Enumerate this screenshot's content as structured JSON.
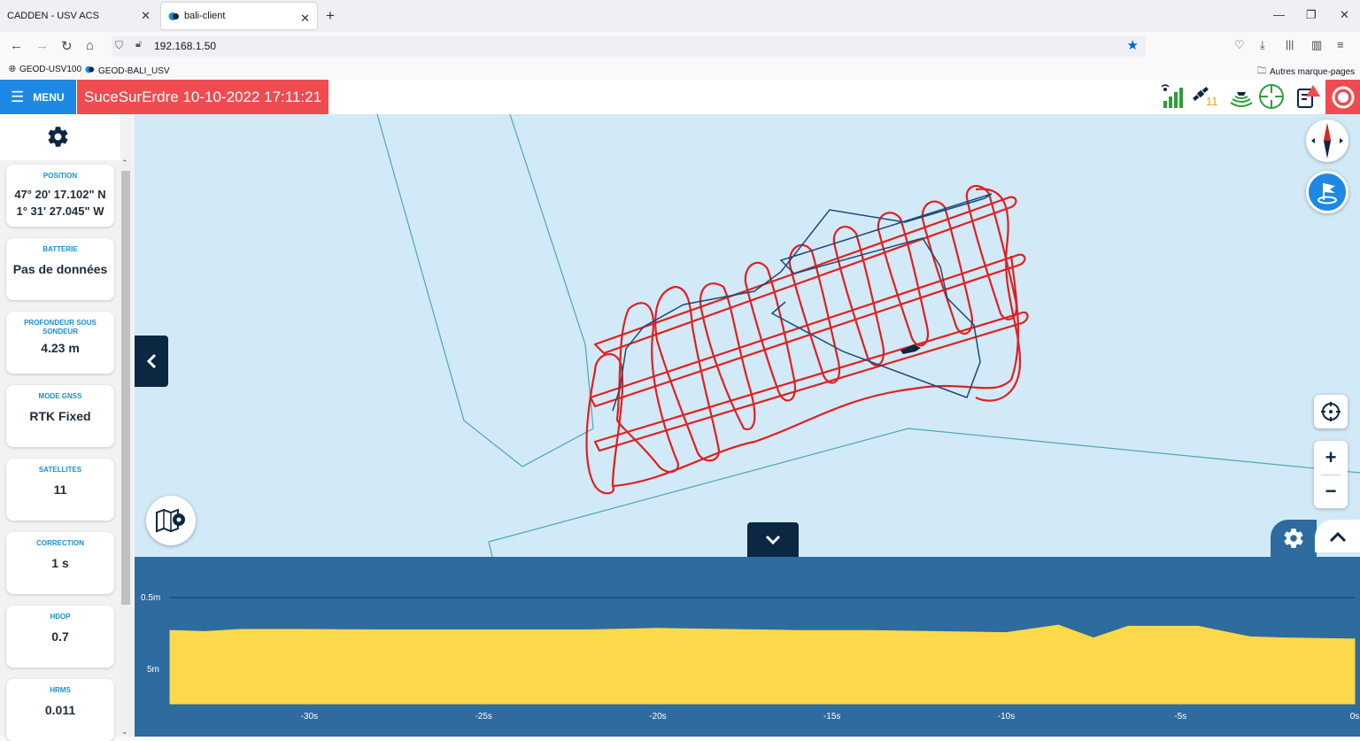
{
  "browser": {
    "tabs": [
      {
        "title": "CADDEN - USV ACS"
      },
      {
        "title": "bali-client"
      }
    ],
    "url": "192.168.1.50",
    "bookmarks": [
      "GEOD-USV100",
      "GEOD-BALI_USV"
    ],
    "other_bookmarks": "Autres marque-pages"
  },
  "app": {
    "menu_label": "MENU",
    "title": "SuceSurErdre 10-10-2022 17:11:21",
    "header_icons": [
      "signal-icon",
      "satellite-icon",
      "sonar-icon",
      "crosshair-icon",
      "alert-document-icon",
      "record-stop-icon"
    ],
    "satellites_badge": "11",
    "accent_color": "#1e88e5",
    "title_bg_color": "#f04b50"
  },
  "sidebar": {
    "cards": [
      {
        "label": "POSITION",
        "value": "47° 20' 17.102\" N",
        "value2": "1° 31' 27.045\" W"
      },
      {
        "label": "BATTERIE",
        "value": "Pas de données"
      },
      {
        "label": "PROFONDEUR SOUS SONDEUR",
        "value": "4.23 m"
      },
      {
        "label": "MODE GNSS",
        "value": "RTK Fixed"
      },
      {
        "label": "SATELLITES",
        "value": "11"
      },
      {
        "label": "CORRECTION",
        "value": "1 s"
      },
      {
        "label": "HDOP",
        "value": "0.7"
      },
      {
        "label": "HRMS",
        "value": "0.011"
      }
    ]
  },
  "map": {
    "water_color": "#d2e9f7",
    "track_color": "#e02020",
    "path_color": "#1b4a78",
    "controls": [
      "compass-icon",
      "flag-icon",
      "locate-icon",
      "zoom-in-button",
      "zoom-out-button",
      "map-settings-icon"
    ]
  },
  "depth_chart": {
    "y_labels": [
      "0.5m",
      "5m"
    ],
    "x_labels": [
      "-30s",
      "-25s",
      "-20s",
      "-15s",
      "-10s",
      "-5s",
      "0s"
    ]
  },
  "chart_data": {
    "type": "area",
    "x": [
      -34,
      -33,
      -32,
      -30,
      -28,
      -26,
      -24,
      -22,
      -20,
      -18,
      -16,
      -14,
      -12,
      -10,
      -8.5,
      -7.5,
      -6.5,
      -5.5,
      -4.5,
      -3,
      -2,
      0
    ],
    "values": [
      1.55,
      1.6,
      1.5,
      1.5,
      1.52,
      1.52,
      1.52,
      1.52,
      1.45,
      1.5,
      1.55,
      1.55,
      1.6,
      1.65,
      1.3,
      1.9,
      1.35,
      1.35,
      1.35,
      1.85,
      1.9,
      1.95
    ],
    "xlabel": "",
    "ylabel": "",
    "series_color": "#fbd94a",
    "background_color": "#2e6b9e"
  }
}
